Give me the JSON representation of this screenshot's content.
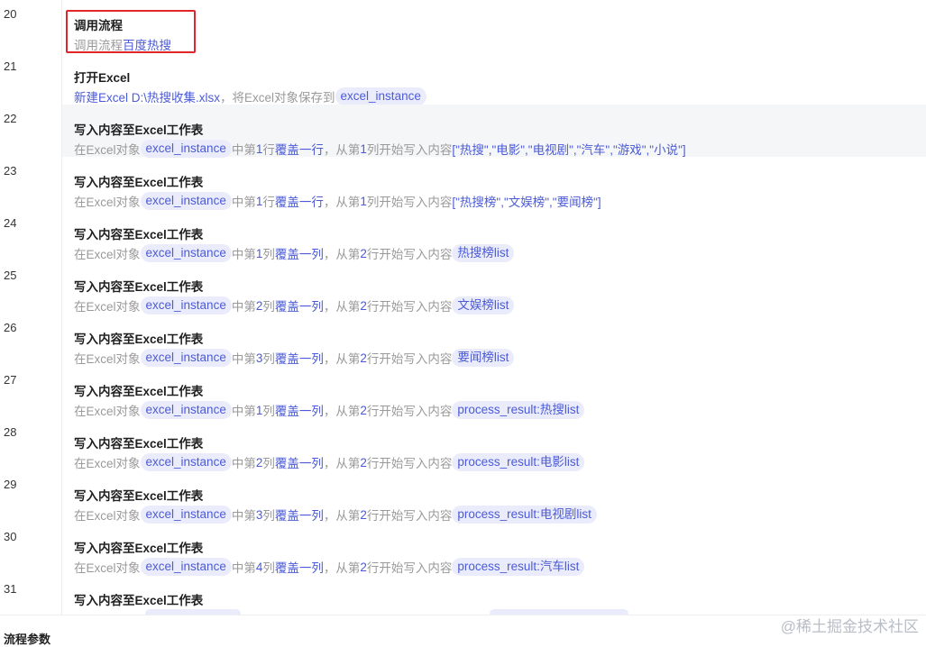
{
  "steps": [
    {
      "line": "20",
      "title": "调用流程",
      "desc": [
        {
          "t": "text",
          "v": "调用流程 "
        },
        {
          "t": "link",
          "v": "百度热搜"
        }
      ]
    },
    {
      "line": "21",
      "title": "打开Excel",
      "desc": [
        {
          "t": "link",
          "v": "新建Excel D:\\热搜收集.xlsx"
        },
        {
          "t": "text",
          "v": "，将Excel对象保存到 "
        },
        {
          "t": "pill",
          "v": "excel_instance"
        }
      ]
    },
    {
      "line": "22",
      "title": "写入内容至Excel工作表",
      "desc": [
        {
          "t": "text",
          "v": "在Excel对象 "
        },
        {
          "t": "pill",
          "v": "excel_instance"
        },
        {
          "t": "text",
          "v": " 中第 "
        },
        {
          "t": "link",
          "v": "1"
        },
        {
          "t": "text",
          "v": " 行 "
        },
        {
          "t": "link",
          "v": "覆盖一行"
        },
        {
          "t": "text",
          "v": "，从第 "
        },
        {
          "t": "link",
          "v": "1"
        },
        {
          "t": "text",
          "v": " 列开始写入内容 "
        },
        {
          "t": "link",
          "v": "[\"热搜\",\"电影\",\"电视剧\",\"汽车\",\"游戏\",\"小说\"]"
        }
      ]
    },
    {
      "line": "23",
      "title": "写入内容至Excel工作表",
      "desc": [
        {
          "t": "text",
          "v": "在Excel对象 "
        },
        {
          "t": "pill",
          "v": "excel_instance"
        },
        {
          "t": "text",
          "v": " 中第 "
        },
        {
          "t": "link",
          "v": "1"
        },
        {
          "t": "text",
          "v": " 行 "
        },
        {
          "t": "link",
          "v": "覆盖一行"
        },
        {
          "t": "text",
          "v": "，从第 "
        },
        {
          "t": "link",
          "v": "1"
        },
        {
          "t": "text",
          "v": " 列开始写入内容 "
        },
        {
          "t": "link",
          "v": "[\"热搜榜\",\"文娱榜\",\"要闻榜\"]"
        }
      ]
    },
    {
      "line": "24",
      "title": "写入内容至Excel工作表",
      "desc": [
        {
          "t": "text",
          "v": "在Excel对象 "
        },
        {
          "t": "pill",
          "v": "excel_instance"
        },
        {
          "t": "text",
          "v": " 中第 "
        },
        {
          "t": "link",
          "v": "1"
        },
        {
          "t": "text",
          "v": " 列 "
        },
        {
          "t": "link",
          "v": "覆盖一列"
        },
        {
          "t": "text",
          "v": "，从第 "
        },
        {
          "t": "link",
          "v": "2"
        },
        {
          "t": "text",
          "v": " 行开始写入内容 "
        },
        {
          "t": "pill",
          "v": "热搜榜list"
        }
      ]
    },
    {
      "line": "25",
      "title": "写入内容至Excel工作表",
      "desc": [
        {
          "t": "text",
          "v": "在Excel对象 "
        },
        {
          "t": "pill",
          "v": "excel_instance"
        },
        {
          "t": "text",
          "v": " 中第 "
        },
        {
          "t": "link",
          "v": "2"
        },
        {
          "t": "text",
          "v": " 列 "
        },
        {
          "t": "link",
          "v": "覆盖一列"
        },
        {
          "t": "text",
          "v": "，从第 "
        },
        {
          "t": "link",
          "v": "2"
        },
        {
          "t": "text",
          "v": " 行开始写入内容 "
        },
        {
          "t": "pill",
          "v": "文娱榜list"
        }
      ]
    },
    {
      "line": "26",
      "title": "写入内容至Excel工作表",
      "desc": [
        {
          "t": "text",
          "v": "在Excel对象 "
        },
        {
          "t": "pill",
          "v": "excel_instance"
        },
        {
          "t": "text",
          "v": " 中第 "
        },
        {
          "t": "link",
          "v": "3"
        },
        {
          "t": "text",
          "v": " 列 "
        },
        {
          "t": "link",
          "v": "覆盖一列"
        },
        {
          "t": "text",
          "v": "，从第 "
        },
        {
          "t": "link",
          "v": "2"
        },
        {
          "t": "text",
          "v": " 行开始写入内容 "
        },
        {
          "t": "pill",
          "v": "要闻榜list"
        }
      ]
    },
    {
      "line": "27",
      "title": "写入内容至Excel工作表",
      "desc": [
        {
          "t": "text",
          "v": "在Excel对象 "
        },
        {
          "t": "pill",
          "v": "excel_instance"
        },
        {
          "t": "text",
          "v": " 中第 "
        },
        {
          "t": "link",
          "v": "1"
        },
        {
          "t": "text",
          "v": " 列 "
        },
        {
          "t": "link",
          "v": "覆盖一列"
        },
        {
          "t": "text",
          "v": "，从第 "
        },
        {
          "t": "link",
          "v": "2"
        },
        {
          "t": "text",
          "v": " 行开始写入内容 "
        },
        {
          "t": "pill",
          "v": "process_result:热搜list"
        }
      ]
    },
    {
      "line": "28",
      "title": "写入内容至Excel工作表",
      "desc": [
        {
          "t": "text",
          "v": "在Excel对象 "
        },
        {
          "t": "pill",
          "v": "excel_instance"
        },
        {
          "t": "text",
          "v": " 中第 "
        },
        {
          "t": "link",
          "v": "2"
        },
        {
          "t": "text",
          "v": " 列 "
        },
        {
          "t": "link",
          "v": "覆盖一列"
        },
        {
          "t": "text",
          "v": "，从第 "
        },
        {
          "t": "link",
          "v": "2"
        },
        {
          "t": "text",
          "v": " 行开始写入内容 "
        },
        {
          "t": "pill",
          "v": "process_result:电影list"
        }
      ]
    },
    {
      "line": "29",
      "title": "写入内容至Excel工作表",
      "desc": [
        {
          "t": "text",
          "v": "在Excel对象 "
        },
        {
          "t": "pill",
          "v": "excel_instance"
        },
        {
          "t": "text",
          "v": " 中第 "
        },
        {
          "t": "link",
          "v": "3"
        },
        {
          "t": "text",
          "v": " 列 "
        },
        {
          "t": "link",
          "v": "覆盖一列"
        },
        {
          "t": "text",
          "v": "，从第 "
        },
        {
          "t": "link",
          "v": "2"
        },
        {
          "t": "text",
          "v": " 行开始写入内容 "
        },
        {
          "t": "pill",
          "v": "process_result:电视剧list"
        }
      ]
    },
    {
      "line": "30",
      "title": "写入内容至Excel工作表",
      "desc": [
        {
          "t": "text",
          "v": "在Excel对象 "
        },
        {
          "t": "pill",
          "v": "excel_instance"
        },
        {
          "t": "text",
          "v": " 中第 "
        },
        {
          "t": "link",
          "v": "4"
        },
        {
          "t": "text",
          "v": " 列 "
        },
        {
          "t": "link",
          "v": "覆盖一列"
        },
        {
          "t": "text",
          "v": "，从第 "
        },
        {
          "t": "link",
          "v": "2"
        },
        {
          "t": "text",
          "v": " 行开始写入内容 "
        },
        {
          "t": "pill",
          "v": "process_result:汽车list"
        }
      ]
    },
    {
      "line": "31",
      "title": "写入内容至Excel工作表",
      "desc": []
    }
  ],
  "hovered_line": "22",
  "highlighted_line": "20",
  "bottom_label": "流程参数",
  "watermark": "@稀土掘金技术社区",
  "colors": {
    "accent": "#4b5bd8",
    "pill_bg": "#ebecfb",
    "muted_text": "#9a9a9a",
    "highlight_border": "#e0262b",
    "hover_row": "#f5f6f8"
  }
}
